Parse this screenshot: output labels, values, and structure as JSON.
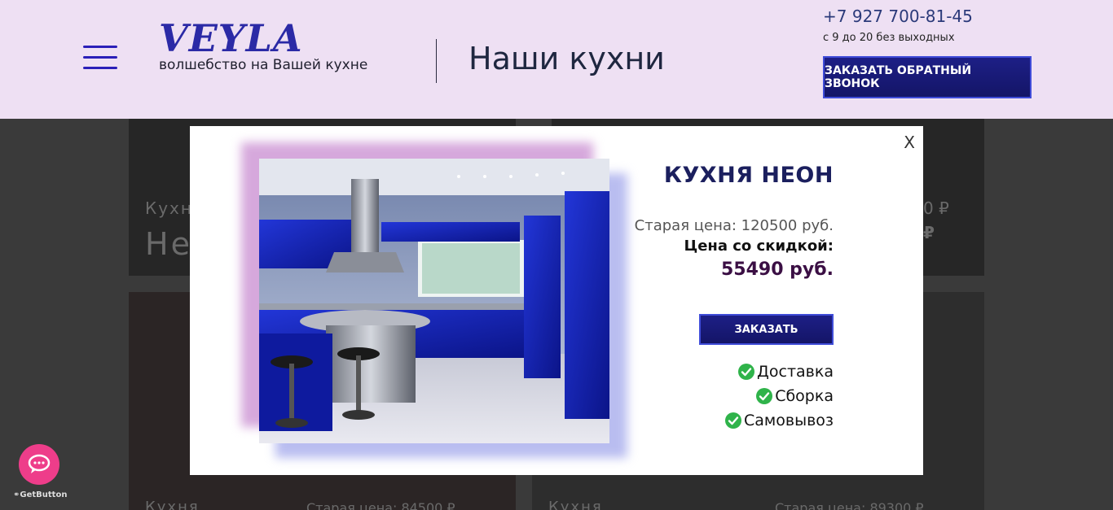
{
  "header": {
    "logo_text": "VEYLA",
    "logo_tagline": "волшебство на Вашей кухне",
    "page_title": "Наши кухни",
    "phone": "+7 927 700-81-45",
    "hours": "с 9 до 20 без выходных",
    "callback_button": "ЗАКАЗАТЬ ОБРАТНЫЙ ЗВОНОК"
  },
  "background": {
    "card1_label": "Кухн",
    "card1_name": "Не",
    "card2_price_old": "0 ₽",
    "card2_price_new": "₽",
    "card3_label": "Кухня",
    "card3_price": "Старая цена: 84500 ₽",
    "card4_label": "Кухня",
    "card4_price": "Старая цена: 89300 ₽"
  },
  "modal": {
    "close_label": "X",
    "product_title": "КУХНЯ НЕОН",
    "old_price": "Старая цена: 120500 руб.",
    "sale_label": "Цена со скидкой:",
    "sale_price": "55490 руб.",
    "order_button": "ЗАКАЗАТЬ",
    "features": [
      "Доставка",
      "Сборка",
      "Самовывоз"
    ]
  },
  "widget": {
    "label": "GetButton"
  },
  "colors": {
    "header_bg": "#eee0f3",
    "accent_blue": "#1d1f86",
    "price_color": "#3b0f44",
    "check_green": "#2fb34a",
    "widget_pink": "#ee3d8a"
  }
}
